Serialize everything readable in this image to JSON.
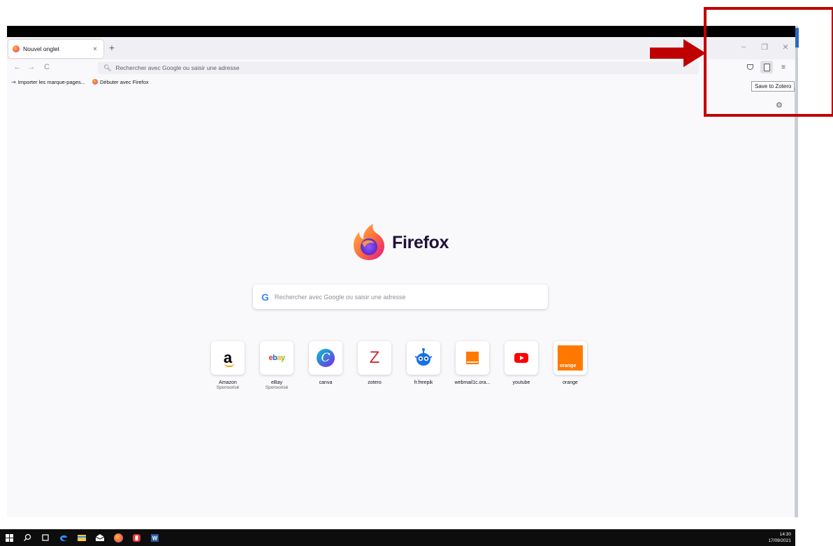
{
  "browser": {
    "tab_title": "Nouvel onglet",
    "tab_close": "×",
    "new_tab": "+",
    "window_controls": {
      "minimize": "–",
      "restore": "❐",
      "close": "✕"
    },
    "nav": {
      "back": "←",
      "forward": "→",
      "reload": "C"
    },
    "urlbar_placeholder": "Rechercher avec Google ou saisir une adresse",
    "menu_glyph": "≡",
    "tooltip": "Save to Zotero",
    "settings_glyph": "⚙"
  },
  "bookmarks": [
    {
      "label": "Importer les marque-pages...",
      "icon": "import-icon"
    },
    {
      "label": "Débuter avec Firefox",
      "icon": "firefox-icon"
    }
  ],
  "newtab": {
    "brand": "Firefox",
    "search_icon": "G",
    "search_placeholder": "Rechercher avec Google ou saisir une adresse",
    "tiles": [
      {
        "name": "Amazon",
        "sub": "Sponsorisé",
        "logo": "a"
      },
      {
        "name": "eBay",
        "sub": "Sponsorisé",
        "logo": "ebay"
      },
      {
        "name": "canva",
        "sub": "",
        "logo": "C"
      },
      {
        "name": "zotero",
        "sub": "",
        "logo": "Z"
      },
      {
        "name": "fr.freepik",
        "sub": "",
        "logo": ""
      },
      {
        "name": "webmail1c.ora...",
        "sub": "",
        "logo": ""
      },
      {
        "name": "youtube",
        "sub": "",
        "logo": ""
      },
      {
        "name": "orange",
        "sub": "",
        "logo": "orange"
      }
    ]
  },
  "taskbar": {
    "time": "14:30",
    "date": "17/09/2021"
  },
  "colors": {
    "annotation": "#c00000",
    "firefox_orange": "#ff7139",
    "firefox_purple": "#9059ff",
    "orange_brand": "#ff7900"
  }
}
